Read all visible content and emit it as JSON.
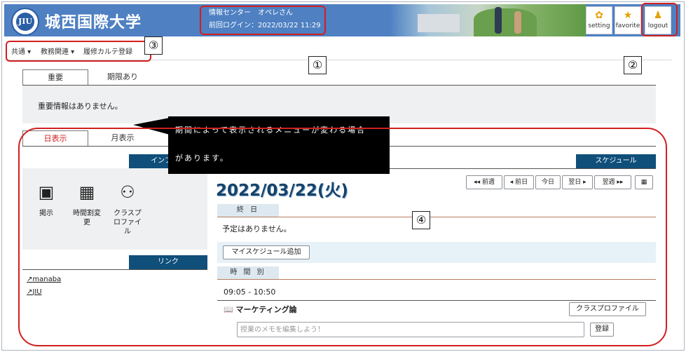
{
  "header": {
    "logo_text": "JIU",
    "university_name": "城西国際大学",
    "user_line": "情報センター　オペレさん",
    "last_login": "前回ログイン：2022/03/22 11:29",
    "buttons": [
      {
        "label": "setting",
        "icon": "gear-icon"
      },
      {
        "label": "favorite",
        "icon": "star-icon"
      },
      {
        "label": "logout",
        "icon": "runner-icon"
      }
    ]
  },
  "nav": {
    "items": [
      "共通",
      "教務関連",
      "履修カルテ登録"
    ]
  },
  "annotations": [
    "①",
    "②",
    "③",
    "④"
  ],
  "notice": {
    "tabs": [
      "重要",
      "期限あり"
    ],
    "message": "重要情報はありません。"
  },
  "callout": {
    "line1": "期間によって表示されるメニューが変わる場合",
    "line2": "があります。"
  },
  "view_tabs": [
    "日表示",
    "月表示"
  ],
  "info": {
    "header": "インフォメ",
    "tiles": [
      {
        "label": "掲示",
        "icon": "bulletin-board-icon"
      },
      {
        "label": "時間割変更",
        "icon": "timetable-icon"
      },
      {
        "label": "クラスプロファイル",
        "icon": "class-group-icon"
      }
    ]
  },
  "links": {
    "header": "リンク",
    "items": [
      "manaba",
      "JIU"
    ]
  },
  "schedule": {
    "header": "スケジュール",
    "date": "2022/03/22(火)",
    "nav_buttons": [
      "◂◂ 前週",
      "◂ 前日",
      "今日",
      "翌日 ▸",
      "翌週 ▸▸"
    ],
    "all_day_label": "終 日",
    "no_plans": "予定はありません。",
    "add_button": "マイスケジュール追加",
    "timed_label": "時 間 別",
    "time_range": "09:05 - 10:50",
    "course_name": "マーケティング論",
    "class_profile_button": "クラスプロファイル",
    "memo_placeholder": "授業のメモを編集しよう！",
    "register_button": "登録"
  }
}
